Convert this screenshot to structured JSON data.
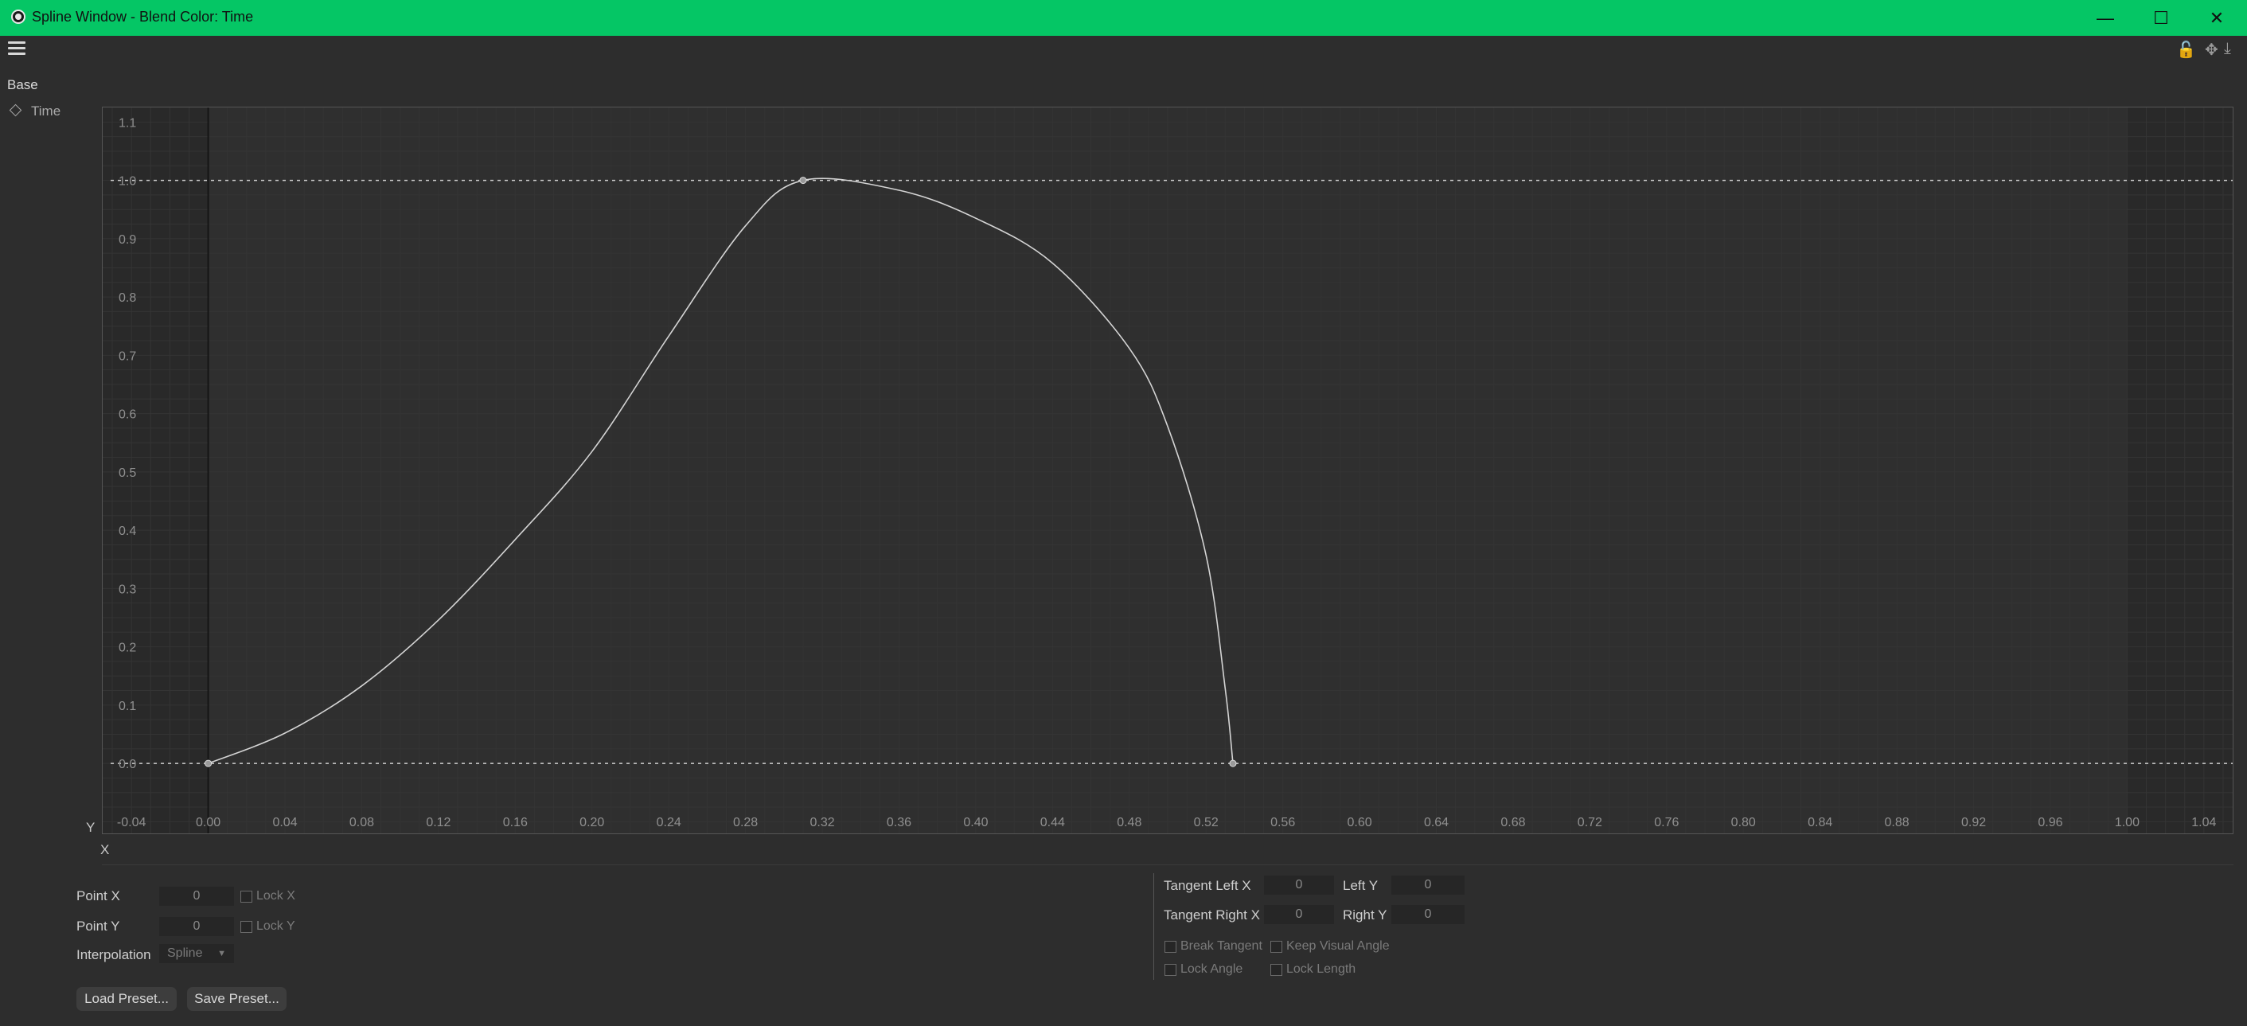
{
  "window": {
    "title": "Spline Window - Blend Color: Time",
    "minimize_glyph": "—",
    "maximize_glyph": "☐",
    "close_glyph": "✕"
  },
  "icons": {
    "menu": "hamburger-icon",
    "lock": "lock-icon",
    "move": "move-icon",
    "export": "export-icon"
  },
  "tree": {
    "group": "Base",
    "items": [
      {
        "label": "Time"
      }
    ]
  },
  "chart_data": {
    "type": "line",
    "x_axis_letter": "X",
    "y_axis_letter": "Y",
    "xlim": [
      -0.055,
      1.055
    ],
    "ylim": [
      -0.12,
      1.125
    ],
    "x_ticks": [
      -0.04,
      0.0,
      0.04,
      0.08,
      0.12,
      0.16,
      0.2,
      0.24,
      0.28,
      0.32,
      0.36,
      0.4,
      0.44,
      0.48,
      0.52,
      0.56,
      0.6,
      0.64,
      0.68,
      0.72,
      0.76,
      0.8,
      0.84,
      0.88,
      0.92,
      0.96,
      1.0,
      1.04
    ],
    "x_tick_labels": [
      "-0.04",
      "0.00",
      "0.04",
      "0.08",
      "0.12",
      "0.16",
      "0.20",
      "0.24",
      "0.28",
      "0.32",
      "0.36",
      "0.40",
      "0.44",
      "0.48",
      "0.52",
      "0.56",
      "0.60",
      "0.64",
      "0.68",
      "0.72",
      "0.76",
      "0.80",
      "0.84",
      "0.88",
      "0.92",
      "0.96",
      "1.00",
      "1.04"
    ],
    "y_ticks": [
      0.0,
      0.1,
      0.2,
      0.3,
      0.4,
      0.5,
      0.6,
      0.7,
      0.8,
      0.9,
      1.0,
      1.1
    ],
    "y_tick_labels": [
      "0.0",
      "0.1",
      "0.2",
      "0.3",
      "0.4",
      "0.5",
      "0.6",
      "0.7",
      "0.8",
      "0.9",
      "1.0",
      "1.1"
    ],
    "grid": true,
    "limit_lines_y": [
      0.0,
      1.0
    ],
    "knots": [
      {
        "x": 0.0,
        "y": 0.0
      },
      {
        "x": 0.31,
        "y": 1.0
      },
      {
        "x": 0.534,
        "y": 0.0
      }
    ],
    "curve": [
      {
        "x": 0.0,
        "y": 0.0
      },
      {
        "x": 0.04,
        "y": 0.052
      },
      {
        "x": 0.08,
        "y": 0.133
      },
      {
        "x": 0.12,
        "y": 0.246
      },
      {
        "x": 0.16,
        "y": 0.384
      },
      {
        "x": 0.2,
        "y": 0.535
      },
      {
        "x": 0.24,
        "y": 0.733
      },
      {
        "x": 0.28,
        "y": 0.922
      },
      {
        "x": 0.31,
        "y": 1.0
      },
      {
        "x": 0.36,
        "y": 0.983
      },
      {
        "x": 0.4,
        "y": 0.935
      },
      {
        "x": 0.44,
        "y": 0.858
      },
      {
        "x": 0.48,
        "y": 0.712
      },
      {
        "x": 0.5,
        "y": 0.578
      },
      {
        "x": 0.52,
        "y": 0.357
      },
      {
        "x": 0.53,
        "y": 0.128
      },
      {
        "x": 0.534,
        "y": 0.0
      }
    ]
  },
  "point_panel": {
    "point_x_label": "Point X",
    "point_x_value": "0",
    "lock_x_label": "Lock X",
    "point_y_label": "Point Y",
    "point_y_value": "0",
    "lock_y_label": "Lock Y",
    "interpolation_label": "Interpolation",
    "interpolation_value": "Spline"
  },
  "tangent_panel": {
    "tangent_left_x_label": "Tangent Left X",
    "tangent_left_x_value": "0",
    "left_y_label": "Left Y",
    "left_y_value": "0",
    "tangent_right_x_label": "Tangent Right X",
    "tangent_right_x_value": "0",
    "right_y_label": "Right Y",
    "right_y_value": "0",
    "break_tangent_label": "Break Tangent",
    "keep_visual_angle_label": "Keep Visual Angle",
    "lock_angle_label": "Lock Angle",
    "lock_length_label": "Lock Length"
  },
  "buttons": {
    "load_preset": "Load Preset...",
    "save_preset": "Save Preset..."
  }
}
